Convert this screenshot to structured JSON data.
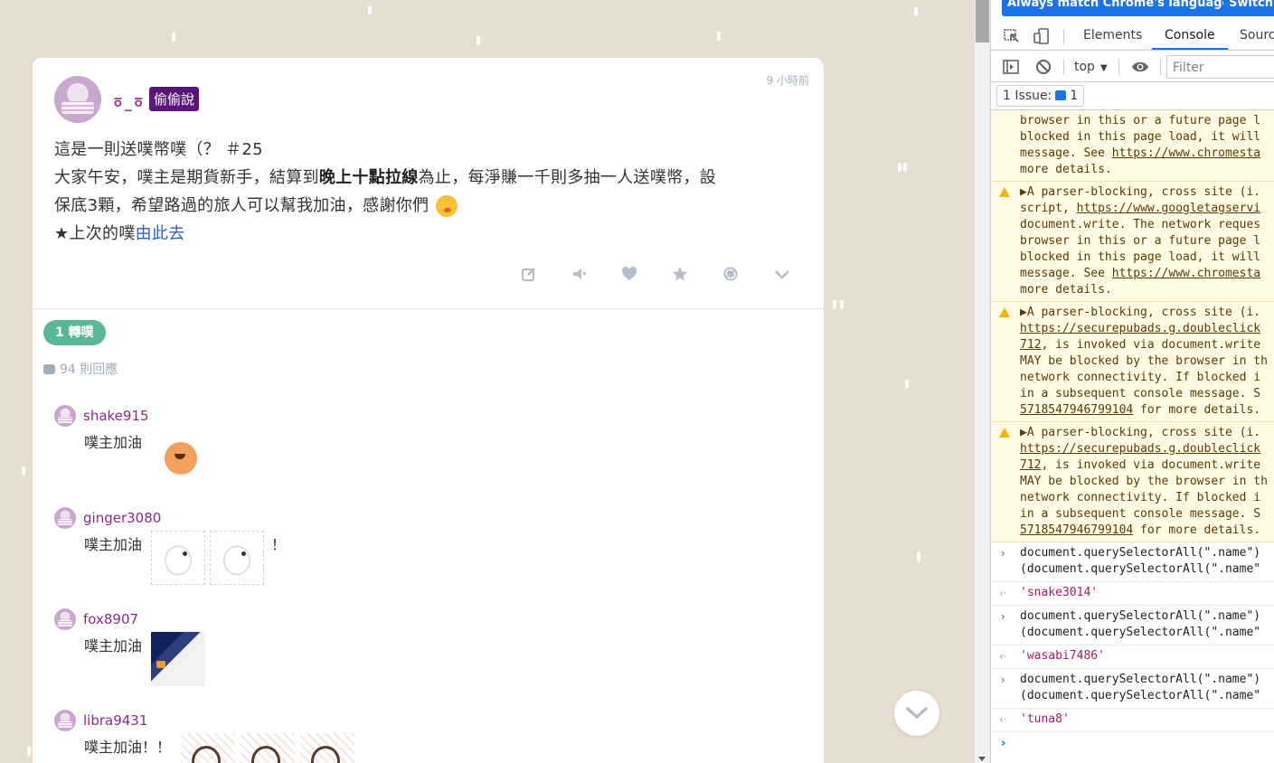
{
  "post": {
    "nickname": "ㆆ_ㆆ",
    "badge": "偷偷說",
    "time": "9 小時前",
    "line1": "這是一則送噗幣噗（？ ＃25",
    "line2_pre": "大家午安，噗主是期貨新手，結算到",
    "line2_bold": "晚上十點拉線",
    "line2_post": "為止，每淨賺一千則多抽一人送噗幣，設",
    "line3": "保底3顆，希望路過的旅人可以幫我加油，感謝你們",
    "line4_pre": "★上次的噗",
    "line4_link": "由此去",
    "emoji": "thinking-face-emoji",
    "replurks": "1 轉噗",
    "responses": "94 則回應",
    "accent_color": "#5b157a",
    "replurk_color": "#5ab795"
  },
  "actions": [
    "edit-icon",
    "mute-icon",
    "like-icon",
    "favorite-icon",
    "replurk-icon",
    "more-chevron-icon"
  ],
  "replies": [
    {
      "user": "shake915",
      "text": "噗主加油",
      "stickers": [
        "dog-sticker"
      ]
    },
    {
      "user": "ginger3080",
      "text": "噗主加油",
      "stickers": [
        "fish-sticker",
        "fish-sticker"
      ],
      "suffix": "！"
    },
    {
      "user": "fox8907",
      "text": "噗主加油",
      "stickers": [
        "bird-sticker"
      ]
    },
    {
      "user": "libra9431",
      "text": "噗主加油！！",
      "stickers": [
        "fist-sticker",
        "fist-sticker",
        "fist-sticker"
      ]
    }
  ],
  "devtools": {
    "lang_btn_1": "Always match Chrome's language",
    "lang_btn_2": "Switch L",
    "tabs": [
      "Elements",
      "Console",
      "Sourc"
    ],
    "context": "top",
    "filter_placeholder": "Filter",
    "issues_label": "1 Issue:",
    "issues_count": "1",
    "warnings": [
      {
        "lines": [
          "browser in this or a future page l",
          "blocked in this page load, it will",
          "message. See |https://www.chromesta",
          "more details."
        ],
        "icon": false
      },
      {
        "lines": [
          "▶A parser-blocking, cross site (i.",
          "script, |https://www.googletagservi",
          "document.write. The network reques",
          "browser in this or a future page l",
          "blocked in this page load, it will",
          "message. See |https://www.chromesta",
          "more details."
        ],
        "icon": true
      },
      {
        "lines": [
          "▶A parser-blocking, cross site (i.",
          "|https://securepubads.g.doubleclick",
          "|712|, is invoked via document.write",
          "MAY be blocked by the browser in th",
          "network connectivity. If blocked i",
          "in a subsequent console message. S",
          "|5718547946799104| for more details."
        ],
        "icon": true
      },
      {
        "lines": [
          "▶A parser-blocking, cross site (i.",
          "|https://securepubads.g.doubleclick",
          "|712|, is invoked via document.write",
          "MAY be blocked by the browser in th",
          "network connectivity. If blocked i",
          "in a subsequent console message. S",
          "|5718547946799104| for more details."
        ],
        "icon": true
      }
    ],
    "entries": [
      {
        "cmd": [
          "document.querySelectorAll(\".name\")",
          "(document.querySelectorAll(\".name\""
        ],
        "result": "'snake3014'"
      },
      {
        "cmd": [
          "document.querySelectorAll(\".name\")",
          "(document.querySelectorAll(\".name\""
        ],
        "result": "'wasabi7486'"
      },
      {
        "cmd": [
          "document.querySelectorAll(\".name\")",
          "(document.querySelectorAll(\".name\""
        ],
        "result": "'tuna8'"
      }
    ]
  }
}
